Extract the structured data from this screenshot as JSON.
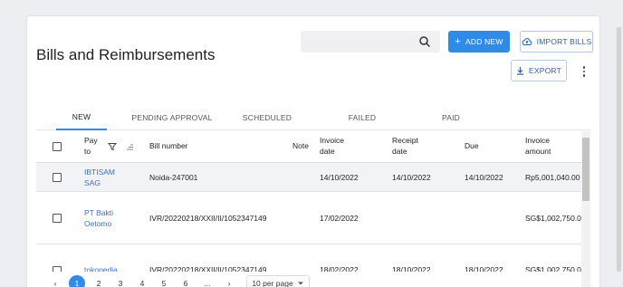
{
  "page": {
    "title": "Bills and Reimbursements",
    "search": {
      "placeholder": ""
    },
    "actions": {
      "add_new": "ADD NEW",
      "import_bills": "IMPORT BILLS",
      "export": "EXPORT"
    }
  },
  "tabs": [
    {
      "label": "NEW",
      "active": true
    },
    {
      "label": "PENDING APPROVAL",
      "active": false
    },
    {
      "label": "SCHEDULED",
      "active": false
    },
    {
      "label": "FAILED",
      "active": false
    },
    {
      "label": "PAID",
      "active": false
    }
  ],
  "table": {
    "headers": {
      "pay_to": "Pay to",
      "bill_number": "Bill number",
      "note": "Note",
      "invoice_date": "Invoice date",
      "receipt_date": "Receipt date",
      "due": "Due",
      "invoice_amount": "Invoice amount"
    },
    "rows": [
      {
        "pay_to": "IBTISAM SAG",
        "bill_number": "Noida-247001",
        "note": "",
        "invoice_date": "14/10/2022",
        "receipt_date": "14/10/2022",
        "due": "14/10/2022",
        "invoice_amount": "Rp5,001,040.00"
      },
      {
        "pay_to": "PT Bakti Oetomo",
        "bill_number": "IVR/20220218/XXII/II/1052347149",
        "note": "",
        "invoice_date": "17/02/2022",
        "receipt_date": "",
        "due": "",
        "invoice_amount": "SG$1,002,750.0"
      },
      {
        "pay_to": "tokopedia",
        "bill_number": "IVR/20220218/XXII/II/1052347149",
        "note": "",
        "invoice_date": "18/02/2022",
        "receipt_date": "18/10/2022",
        "due": "18/10/2022",
        "invoice_amount": "SG$1,002,750.0"
      }
    ]
  },
  "pagination": {
    "prev": "‹",
    "pages": [
      "1",
      "2",
      "3",
      "4",
      "5",
      "6",
      "...",
      "›"
    ],
    "active_page": "1",
    "per_page": "10 per page"
  },
  "colors": {
    "accent": "#2f8be6",
    "link": "#3a72c0",
    "highlight_row": "#f1f3f6"
  }
}
